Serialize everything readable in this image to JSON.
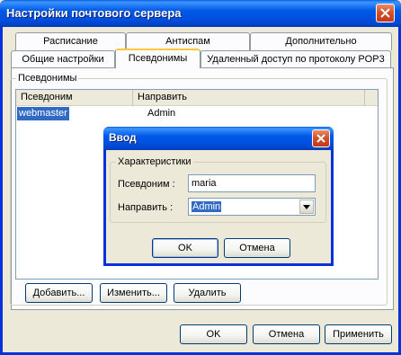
{
  "window": {
    "title": "Настройки почтового сервера",
    "close_label": "✕"
  },
  "tabs": {
    "row_back": [
      {
        "label": "Расписание"
      },
      {
        "label": "Антиспам"
      },
      {
        "label": "Дополнительно"
      }
    ],
    "row_front": [
      {
        "label": "Общие настройки"
      },
      {
        "label": "Псевдонимы"
      },
      {
        "label": "Удаленный доступ по протоколу POP3"
      }
    ],
    "active": "Псевдонимы"
  },
  "aliases_group": {
    "legend": "Псевдонимы",
    "columns": [
      "Псевдоним",
      "Направить"
    ],
    "rows": [
      {
        "alias": "webmaster",
        "target": "Admin",
        "selected": true
      }
    ],
    "buttons": {
      "add": "Добавить...",
      "edit": "Изменить...",
      "delete": "Удалить"
    }
  },
  "dialog": {
    "title": "Ввод",
    "group_legend": "Характеристики",
    "alias_label": "Псевдоним :",
    "alias_value": "maria",
    "forward_label": "Направить :",
    "forward_value": "Admin",
    "ok": "OK",
    "cancel": "Отмена"
  },
  "footer": {
    "ok": "OK",
    "cancel": "Отмена",
    "apply": "Применить"
  },
  "colors": {
    "titlebar": "#0058E6",
    "selection": "#316AC5",
    "close_button": "#D5522B"
  }
}
